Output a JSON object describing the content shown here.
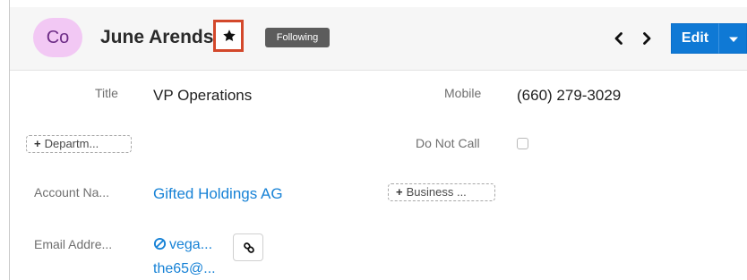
{
  "header": {
    "avatar_initials": "Co",
    "record_name": "June Arends",
    "favorite_icon": "star-icon",
    "following_label": "Following",
    "prev_icon": "chevron-left-icon",
    "next_icon": "chevron-right-icon",
    "edit_label": "Edit",
    "edit_menu_icon": "caret-down-icon",
    "colors": {
      "avatar_bg": "#f2c8f4",
      "avatar_text": "#6d2c86",
      "favorite_outline": "#d3482b",
      "badge_bg": "#5c5c5c",
      "edit_bg": "#0f79d5"
    }
  },
  "fields": {
    "title": {
      "label": "Title",
      "value": "VP Operations"
    },
    "mobile": {
      "label": "Mobile",
      "value": "(660) 279-3029"
    },
    "department": {
      "add_label": "Departm..."
    },
    "do_not_call": {
      "label": "Do Not Call",
      "checked": false
    },
    "account_name": {
      "label": "Account Na...",
      "value": "Gifted Holdings AG"
    },
    "business": {
      "add_label": "Business ..."
    },
    "email": {
      "label": "Email Addre...",
      "line1": "vega...",
      "line2": "the65@...",
      "status_icon": "opted-out-icon",
      "link_icon": "link-icon"
    }
  }
}
